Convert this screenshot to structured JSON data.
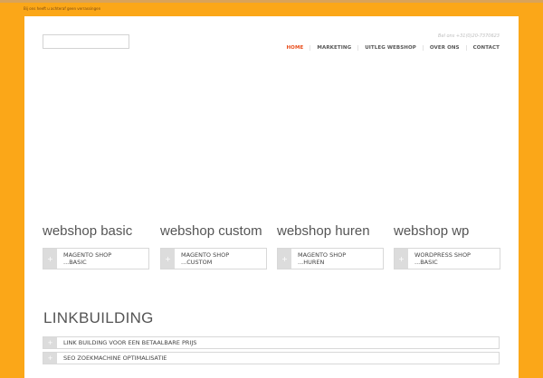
{
  "tagline": "Bij ons heeft u achteraf geen verrassingen",
  "header": {
    "phone": "Bel ons +31(0)20-7370623",
    "nav": [
      {
        "label": "HOME",
        "active": true
      },
      {
        "label": "MARKETING",
        "active": false
      },
      {
        "label": "UITLEG WEBSHOP",
        "active": false
      },
      {
        "label": "OVER ONS",
        "active": false
      },
      {
        "label": "CONTACT",
        "active": false
      }
    ]
  },
  "columns": [
    {
      "title": "webshop basic",
      "toggle_line1": "MAGENTO SHOP",
      "toggle_line2": "...BASIC"
    },
    {
      "title": "webshop custom",
      "toggle_line1": "MAGENTO SHOP",
      "toggle_line2": "...CUSTOM"
    },
    {
      "title": "webshop huren",
      "toggle_line1": "MAGENTO SHOP",
      "toggle_line2": "...HUREN"
    },
    {
      "title": "webshop wp",
      "toggle_line1": "WORDPRESS SHOP",
      "toggle_line2": "...BASIC"
    }
  ],
  "linkbuilding": {
    "title": "LINKBUILDING",
    "items": [
      {
        "label": "LINK BUILDING VOOR EEN BETAALBARE PRIJS"
      },
      {
        "label": "SEO ZOEKMACHINE OPTIMALISATIE"
      }
    ]
  },
  "icons": {
    "toggle_icon": "plus-icon",
    "toggle_glyph": "+"
  },
  "colors": {
    "background": "#fba718",
    "accent": "#e94d1b",
    "panel": "#ffffff"
  }
}
